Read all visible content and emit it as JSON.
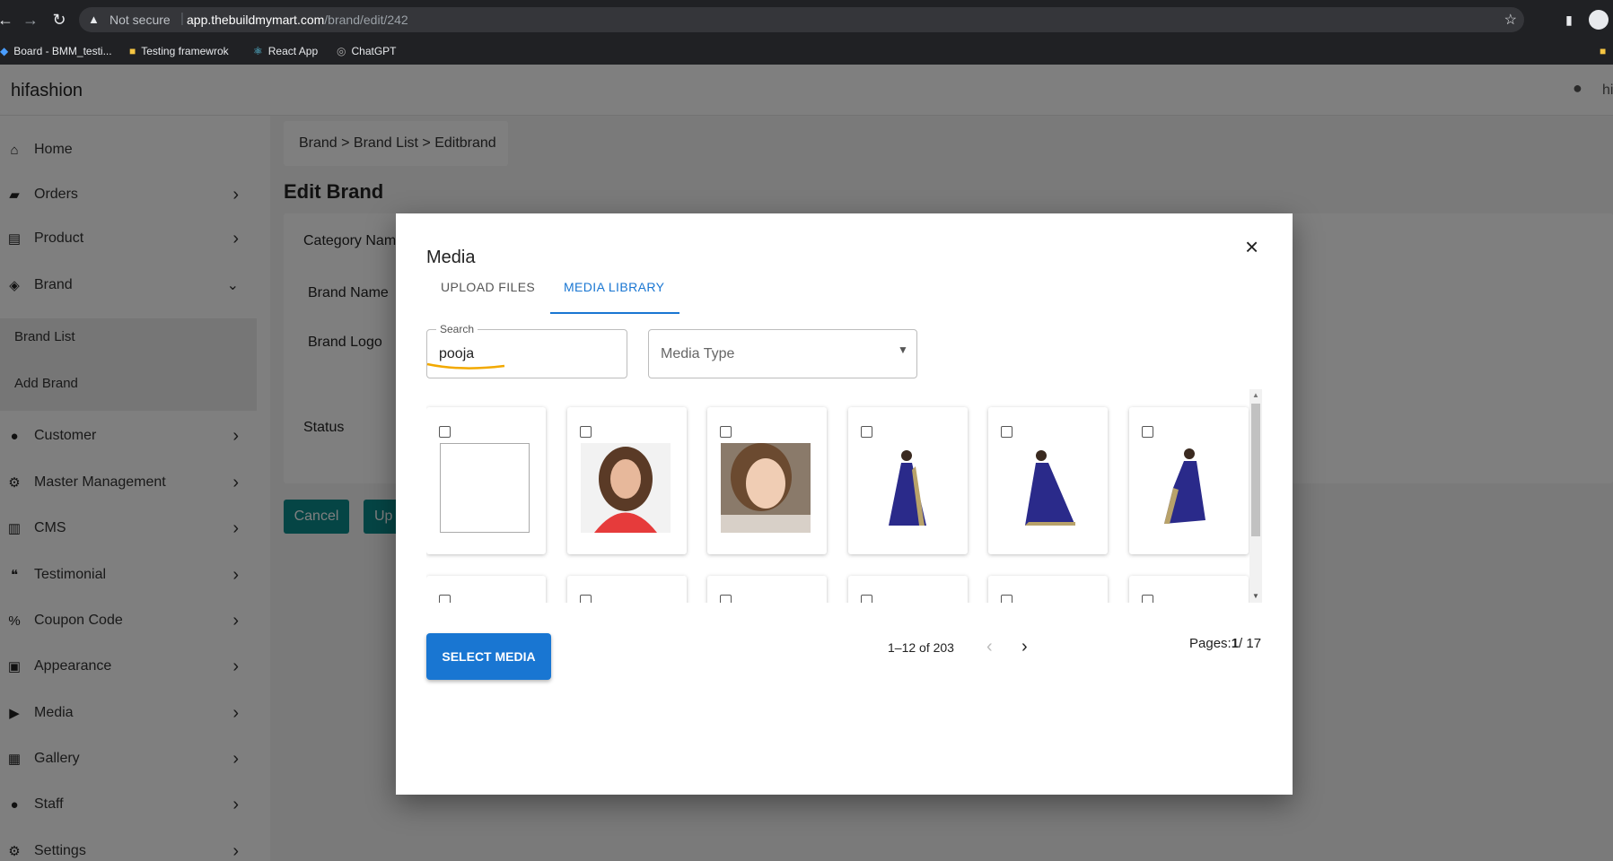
{
  "browser": {
    "security_label": "Not secure",
    "url_domain": "app.thebuildmymart.com",
    "url_path": "/brand/edit/242",
    "bookmarks": [
      "Board - BMM_testi...",
      "Testing framewrok",
      "React App",
      "ChatGPT"
    ]
  },
  "app": {
    "brand": "hifashion",
    "user_label": "hi"
  },
  "sidebar": {
    "items": [
      {
        "label": "Home",
        "icon": "home-icon"
      },
      {
        "label": "Orders",
        "icon": "bag-icon"
      },
      {
        "label": "Product",
        "icon": "archive-icon"
      },
      {
        "label": "Brand",
        "icon": "tag-icon"
      },
      {
        "label": "Brand List"
      },
      {
        "label": "Add Brand"
      },
      {
        "label": "Customer",
        "icon": "person-icon"
      },
      {
        "label": "Master Management",
        "icon": "person-gear-icon"
      },
      {
        "label": "CMS",
        "icon": "document-icon"
      },
      {
        "label": "Testimonial",
        "icon": "quote-icon"
      },
      {
        "label": "Coupon Code",
        "icon": "percent-icon"
      },
      {
        "label": "Appearance",
        "icon": "image-icon"
      },
      {
        "label": "Media",
        "icon": "play-icon"
      },
      {
        "label": "Gallery",
        "icon": "gallery-icon"
      },
      {
        "label": "Staff",
        "icon": "person-icon"
      },
      {
        "label": "Settings",
        "icon": "gear-icon"
      }
    ]
  },
  "main": {
    "breadcrumb": "Brand > Brand List > Editbrand",
    "title": "Edit Brand",
    "fields": [
      "Category Name",
      "Brand Name",
      "Brand Logo",
      "Status"
    ],
    "cancel_label": "Cancel",
    "update_label": "Up"
  },
  "modal": {
    "title": "Media",
    "tabs": [
      "UPLOAD FILES",
      "MEDIA LIBRARY"
    ],
    "active_tab": "MEDIA LIBRARY",
    "search_label": "Search",
    "search_value": "pooja",
    "media_type_placeholder": "Media Type",
    "select_button": "SELECT MEDIA",
    "range_text": "1–12 of 203",
    "pages_label": "Pages:",
    "pages_current": "1",
    "pages_total": "/ 17",
    "accent": "#1976d2"
  }
}
